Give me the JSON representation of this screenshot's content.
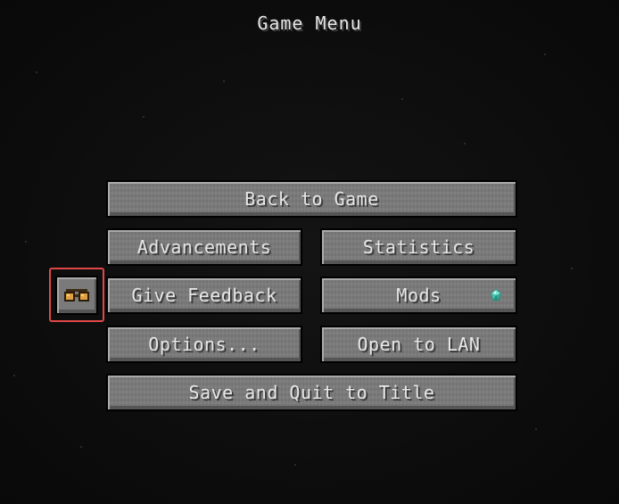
{
  "title": "Game Menu",
  "buttons": {
    "back_to_game": "Back to Game",
    "advancements": "Advancements",
    "statistics": "Statistics",
    "give_feedback": "Give Feedback",
    "mods": "Mods",
    "options": "Options...",
    "open_to_lan": "Open to LAN",
    "save_and_quit": "Save and Quit to Title"
  },
  "icons": {
    "feedback": "goggles-icon",
    "mods_badge": "gem-icon"
  },
  "colors": {
    "background": "#0d0d0d",
    "button_face": "#7a7a7a",
    "button_text": "#e6e6e6",
    "highlight": "#e04848",
    "gem": "#5fd4c0"
  }
}
